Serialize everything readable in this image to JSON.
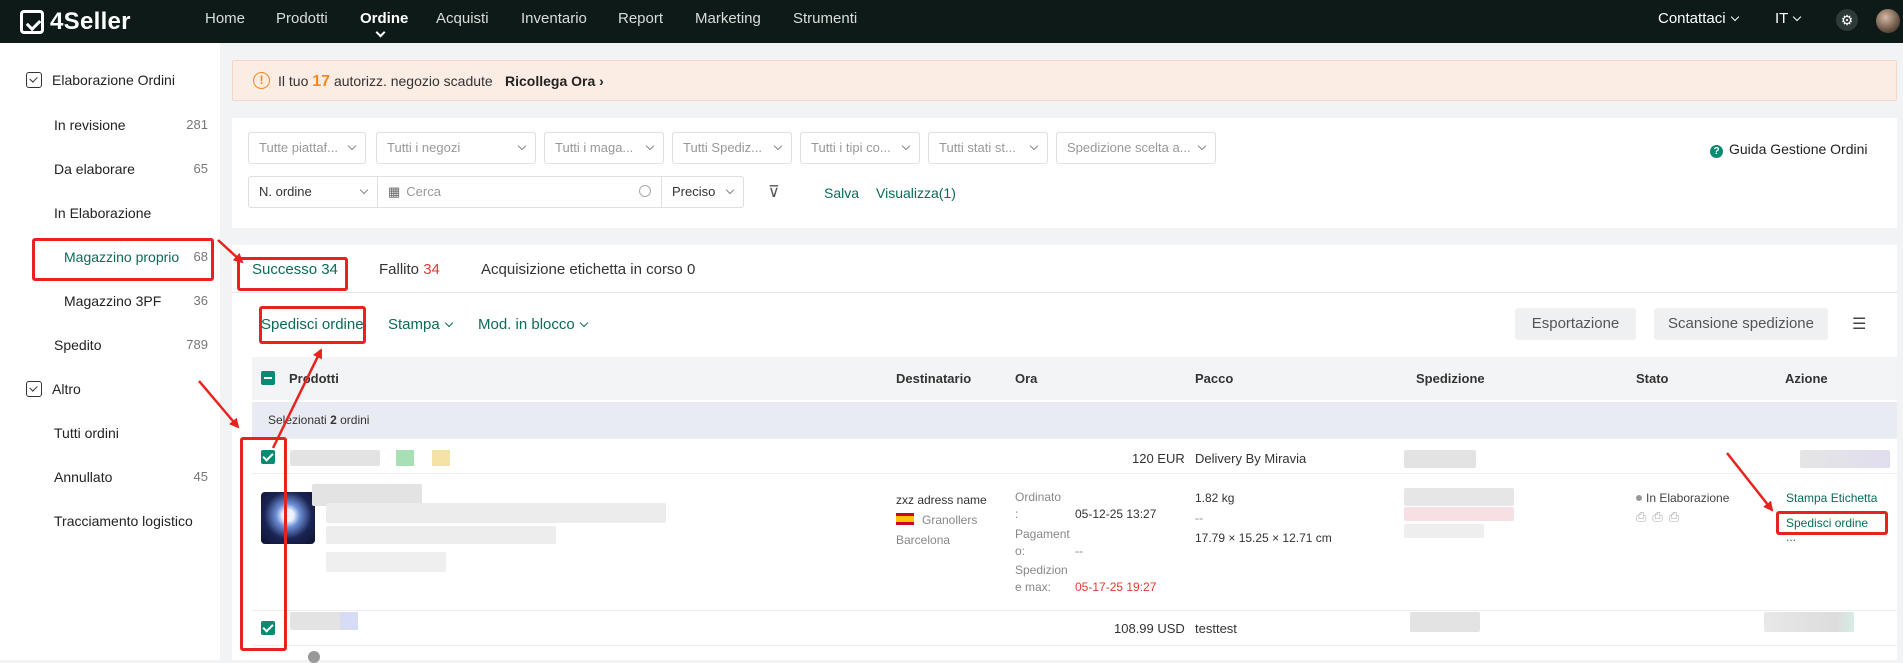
{
  "topbar": {
    "logo": "4Seller",
    "nav": [
      "Home",
      "Prodotti",
      "Ordine",
      "Acquisti",
      "Inventario",
      "Report",
      "Marketing",
      "Strumenti"
    ],
    "active_nav": "Ordine",
    "contact": "Contattaci",
    "language": "IT",
    "icons": [
      "settings-icon",
      "user-avatar"
    ]
  },
  "sidebar": {
    "group1": "Elaborazione Ordini",
    "items": [
      {
        "label": "In revisione",
        "count": "281"
      },
      {
        "label": "Da elaborare",
        "count": "65"
      },
      {
        "label": "In Elaborazione",
        "count": ""
      },
      {
        "label": "Magazzino proprio",
        "count": "68"
      },
      {
        "label": "Magazzino 3PF",
        "count": "36"
      },
      {
        "label": "Spedito",
        "count": "789"
      }
    ],
    "group2": "Altro",
    "items2": [
      {
        "label": "Tutti ordini",
        "count": ""
      },
      {
        "label": "Annullato",
        "count": "45"
      },
      {
        "label": "Tracciamento logistico",
        "count": ""
      }
    ]
  },
  "banner": {
    "prefix": "Il tuo",
    "number": "17",
    "suffix": "autorizz. negozio scadute",
    "link": "Ricollega Ora"
  },
  "filters": {
    "selects": [
      "Tutte piattaf...",
      "Tutti i negozi",
      "Tutti i maga...",
      "Tutti Spediz...",
      "Tutti i tipi co...",
      "Tutti stati st...",
      "Spedizione scelta a..."
    ],
    "search_field": "N. ordine",
    "search_placeholder": "Cerca",
    "match": "Preciso",
    "save": "Salva",
    "view": "Visualizza(1)",
    "guide": "Guida Gestione Ordini"
  },
  "tabs": {
    "success_label": "Successo",
    "success_count": "34",
    "failed_label": "Fallito",
    "failed_count": "34",
    "acquiring": "Acquisizione etichetta in corso 0"
  },
  "toolbar": {
    "ship": "Spedisci ordine",
    "print": "Stampa",
    "bulk": "Mod. in blocco",
    "export": "Esportazione",
    "scan": "Scansione spedizione"
  },
  "table": {
    "headers": [
      "Prodotti",
      "Destinatario",
      "Ora",
      "Pacco",
      "Spedizione",
      "Stato",
      "Azione"
    ],
    "selected_prefix": "Selezionati",
    "selected_count": "2",
    "selected_suffix": "ordini",
    "order1": {
      "amount": "120 EUR",
      "carrier": "Delivery By Miravia",
      "recipient_name": "zxz adress name",
      "city": "Granollers",
      "province": "Barcelona",
      "ordered_label": "Ordinato",
      "ordered_colon": ":",
      "ordered_value": "05-12-25 13:27",
      "payment_label1": "Pagament",
      "payment_label2": "o:",
      "payment_value": "--",
      "ship_label1": "Spedizion",
      "ship_label2": "e max:",
      "ship_value": "05-17-25 19:27",
      "weight": "1.82 kg",
      "dash": "--",
      "dimensions": "17.79 × 15.25 × 12.71 cm",
      "status": "In Elaborazione",
      "action1": "Stampa Etichetta",
      "action2": "Spedisci ordine",
      "more": "..."
    },
    "order2": {
      "amount": "108.99 USD",
      "carrier": "testtest"
    }
  },
  "colors": {
    "accent": "#0b6b58",
    "orange": "#f08a24",
    "red": "#e53935",
    "annotation": "#e8231d"
  }
}
